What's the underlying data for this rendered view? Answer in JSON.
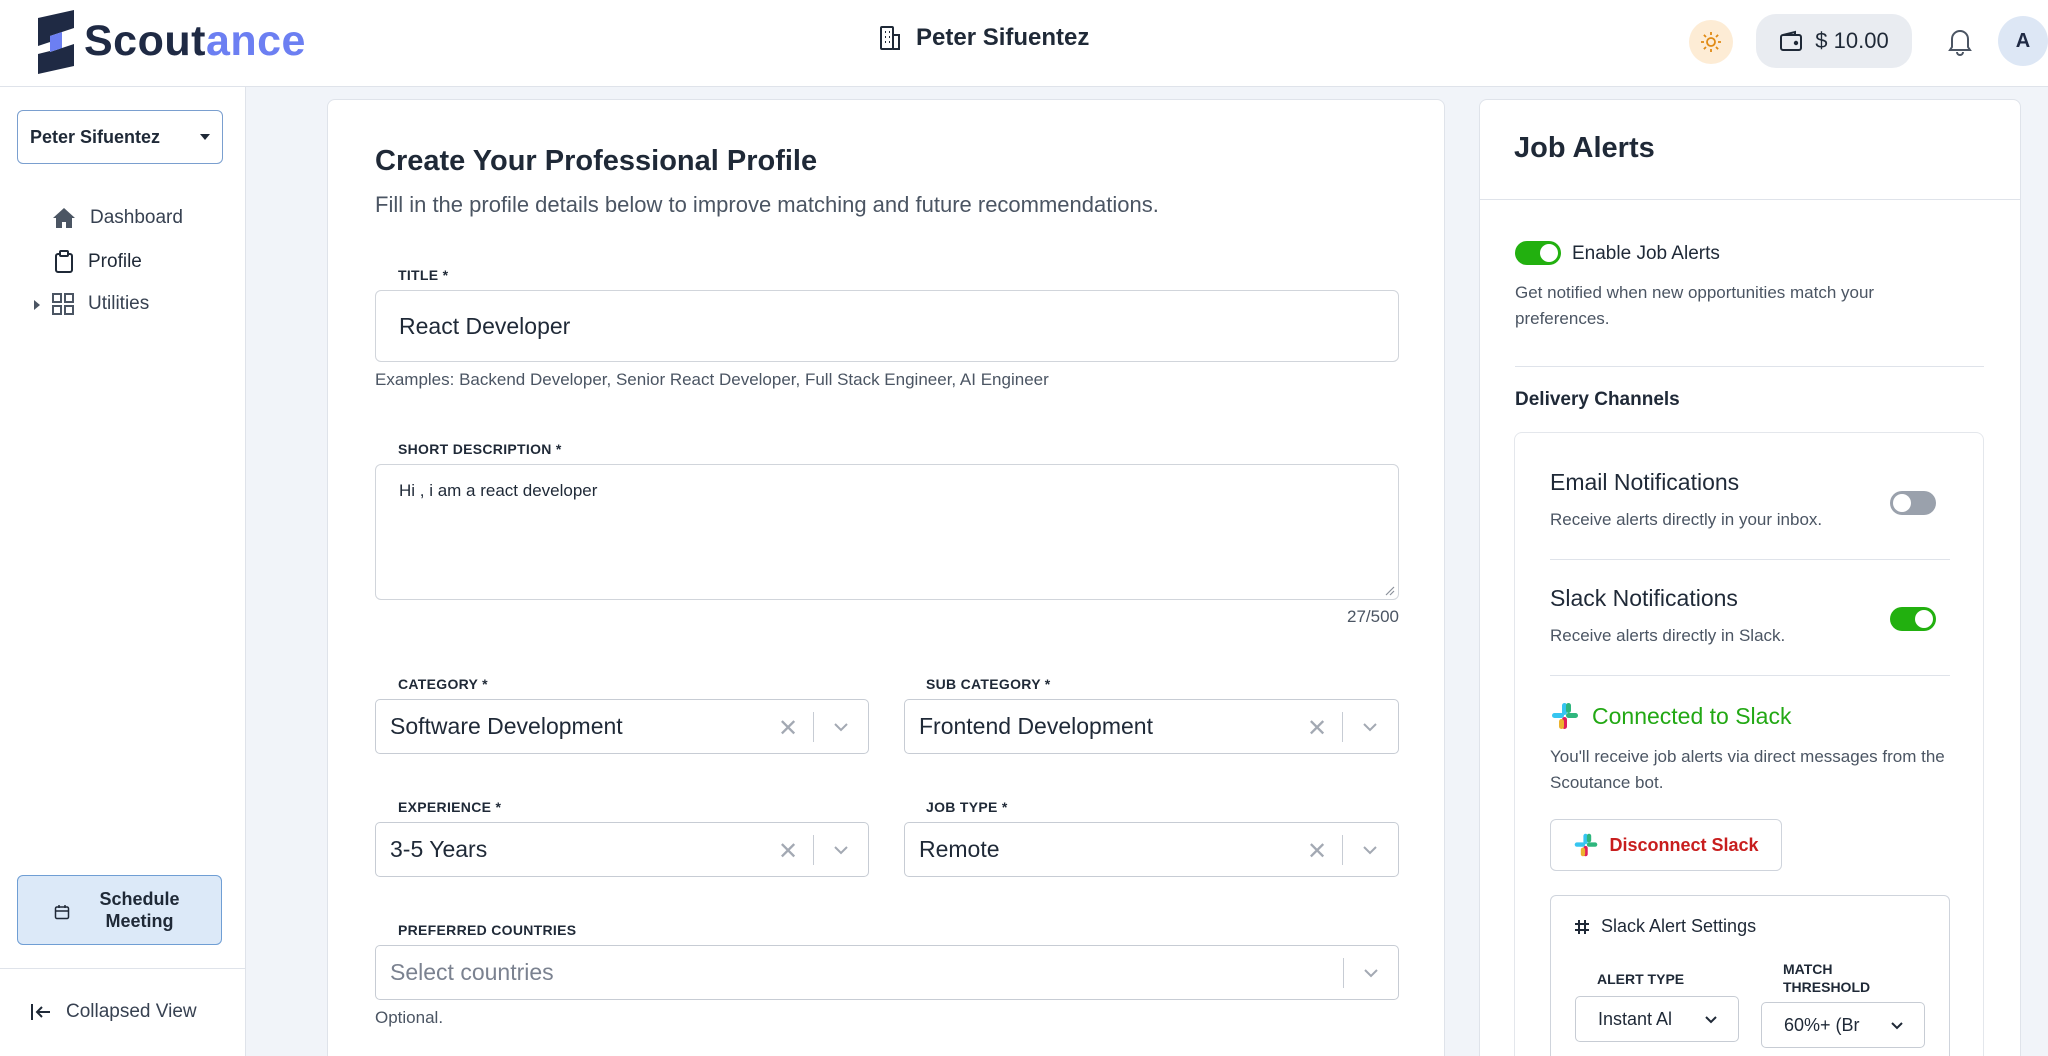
{
  "header": {
    "logo_part1": "Scout",
    "logo_part2": "ance",
    "org_name": "Peter Sifuentez",
    "wallet_amount": "$ 10.00",
    "avatar_initial": "A"
  },
  "sidebar": {
    "user_select": "Peter Sifuentez",
    "items": [
      {
        "label": "Dashboard",
        "icon": "home-icon"
      },
      {
        "label": "Profile",
        "icon": "clipboard-icon"
      },
      {
        "label": "Utilities",
        "icon": "grid-icon"
      }
    ],
    "schedule_label": "Schedule Meeting",
    "collapsed_label": "Collapsed View"
  },
  "profile_form": {
    "title": "Create Your Professional Profile",
    "subtitle": "Fill in the profile details below to improve matching and future recommendations.",
    "title_field": {
      "label": "TITLE *",
      "value": "React Developer",
      "helper": "Examples: Backend Developer, Senior React Developer, Full Stack Engineer, AI Engineer"
    },
    "description_field": {
      "label": "SHORT DESCRIPTION *",
      "value": "Hi , i am a react developer",
      "counter": "27/500"
    },
    "category": {
      "label": "CATEGORY *",
      "value": "Software Development"
    },
    "sub_category": {
      "label": "SUB CATEGORY *",
      "value": "Frontend Development"
    },
    "experience": {
      "label": "EXPERIENCE *",
      "value": "3-5 Years"
    },
    "job_type": {
      "label": "JOB TYPE *",
      "value": "Remote"
    },
    "countries": {
      "label": "PREFERRED COUNTRIES",
      "placeholder": "Select countries",
      "helper": "Optional."
    }
  },
  "job_alerts": {
    "title": "Job Alerts",
    "enable_label": "Enable Job Alerts",
    "enable_desc": "Get notified when new opportunities match your preferences.",
    "delivery_title": "Delivery Channels",
    "email": {
      "title": "Email Notifications",
      "desc": "Receive alerts directly in your inbox.",
      "enabled": false
    },
    "slack": {
      "title": "Slack Notifications",
      "desc": "Receive alerts directly in Slack.",
      "enabled": true
    },
    "connected_label": "Connected to Slack",
    "connected_desc": "You'll receive job alerts via direct messages from the Scoutance bot.",
    "disconnect_label": "Disconnect Slack",
    "settings_title": "Slack Alert Settings",
    "alert_type_label": "ALERT TYPE",
    "alert_type_value": "Instant Al",
    "match_label": "MATCH THRESHOLD",
    "match_value": "60%+ (Br"
  },
  "colors": {
    "brand_dark": "#1f2a44",
    "brand_accent": "#6c7ff2",
    "toggle_on": "#22b00f",
    "slack_connected": "#22a814",
    "danger": "#c81e1e"
  }
}
